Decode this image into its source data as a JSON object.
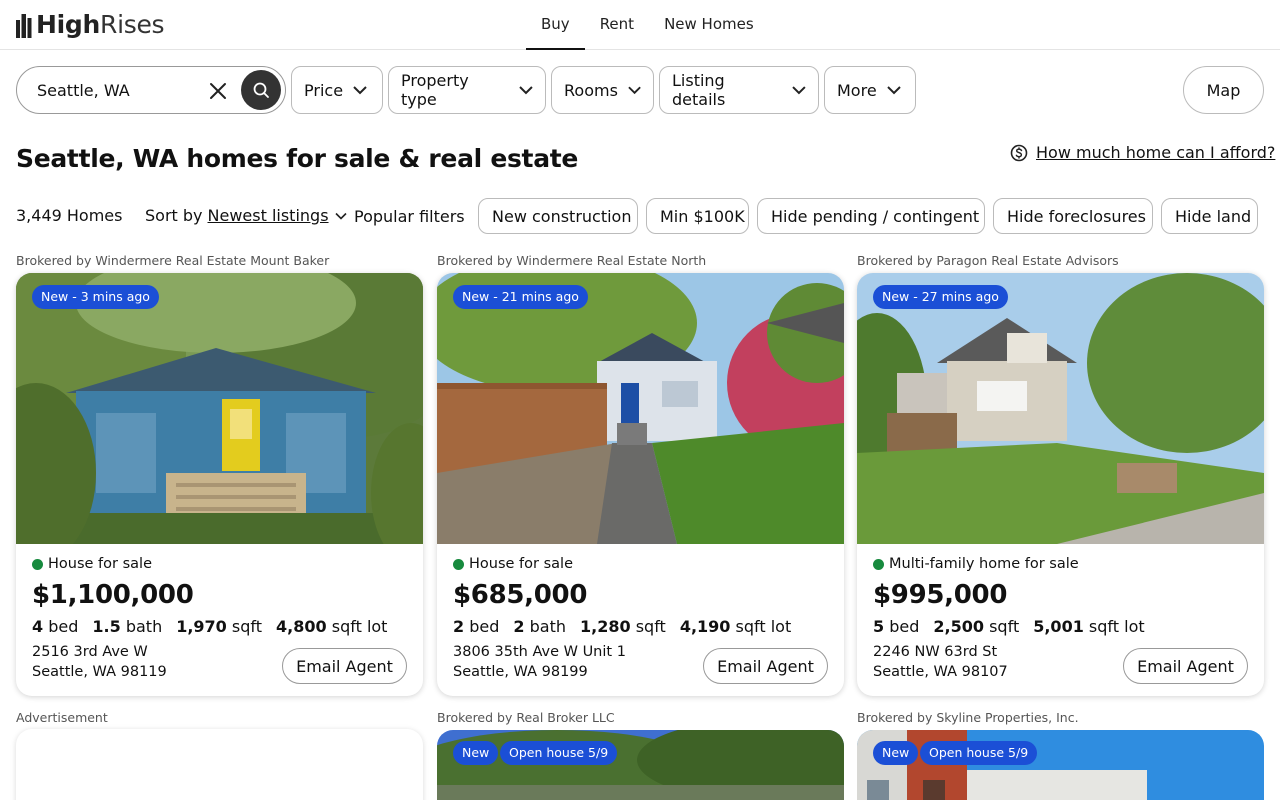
{
  "header": {
    "logo_bold": "High",
    "logo_rest": "Rises",
    "nav": [
      "Buy",
      "Rent",
      "New Homes"
    ],
    "active_nav": "Buy"
  },
  "search": {
    "value": "Seattle, WA"
  },
  "filters": {
    "price": "Price",
    "property_type": "Property type",
    "rooms": "Rooms",
    "listing_details": "Listing details",
    "more": "More",
    "map": "Map"
  },
  "page": {
    "title": "Seattle, WA homes for sale & real estate",
    "afford_link": "How much home can I afford?",
    "count": "3,449 Homes",
    "sort_label": "Sort by",
    "sort_value": "Newest listings",
    "popular_label": "Popular filters",
    "chips": [
      "New construction",
      "Min $100K",
      "Hide pending / contingent",
      "Hide foreclosures",
      "Hide land"
    ]
  },
  "listings": [
    {
      "broker": "Brokered by Windermere Real Estate Mount Baker",
      "badge": "New - 3 mins ago",
      "type": "House for sale",
      "price": "$1,100,000",
      "beds": "4",
      "beds_label": "bed",
      "baths": "1.5",
      "baths_label": "bath",
      "sqft": "1,970",
      "sqft_label": "sqft",
      "lot": "4,800",
      "lot_label": "sqft lot",
      "address1": "2516 3rd Ave W",
      "address2": "Seattle, WA 98119",
      "cta": "Email Agent"
    },
    {
      "broker": "Brokered by Windermere Real Estate North",
      "badge": "New - 21 mins ago",
      "type": "House for sale",
      "price": "$685,000",
      "beds": "2",
      "beds_label": "bed",
      "baths": "2",
      "baths_label": "bath",
      "sqft": "1,280",
      "sqft_label": "sqft",
      "lot": "4,190",
      "lot_label": "sqft lot",
      "address1": "3806 35th Ave W Unit 1",
      "address2": "Seattle, WA 98199",
      "cta": "Email Agent"
    },
    {
      "broker": "Brokered by Paragon Real Estate Advisors",
      "badge": "New - 27 mins ago",
      "type": "Multi-family home for sale",
      "price": "$995,000",
      "beds": "5",
      "beds_label": "bed",
      "sqft": "2,500",
      "sqft_label": "sqft",
      "lot": "5,001",
      "lot_label": "sqft lot",
      "address1": "2246 NW 63rd St",
      "address2": "Seattle, WA 98107",
      "cta": "Email Agent"
    }
  ],
  "second_row": {
    "ad_label": "Advertisement",
    "broker_b": "Brokered by Real Broker LLC",
    "broker_c": "Brokered by Skyline Properties, Inc.",
    "badge_new": "New",
    "badge_open": "Open house 5/9"
  },
  "colors": {
    "badge": "#1b4fd6",
    "status_dot": "#178a3e"
  }
}
